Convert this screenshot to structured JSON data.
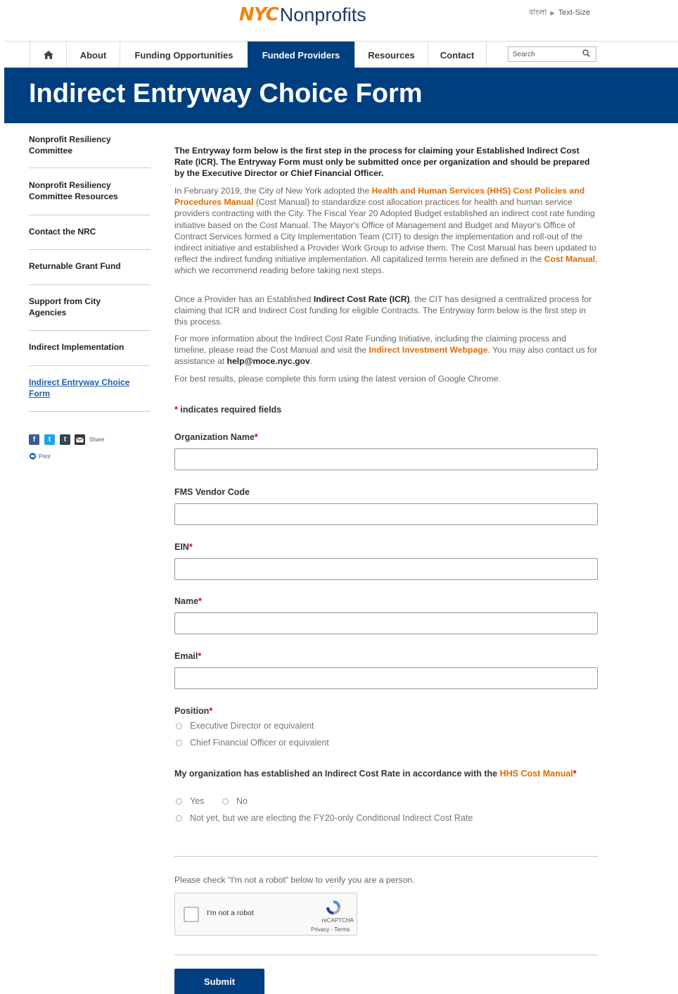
{
  "header": {
    "logo_nyc": "NYC",
    "logo_text": "Nonprofits",
    "lang_link": "বাংলা",
    "text_size": "Text-Size"
  },
  "nav": {
    "items": [
      {
        "label": "About"
      },
      {
        "label": "Funding Opportunities"
      },
      {
        "label": "Funded Providers"
      },
      {
        "label": "Resources"
      },
      {
        "label": "Contact"
      }
    ],
    "search_placeholder": "Search"
  },
  "page_title": "Indirect Entryway Choice Form",
  "sidebar": {
    "items": [
      {
        "label": "Nonprofit Resiliency Committee"
      },
      {
        "label": "Nonprofit Resiliency Committee Resources"
      },
      {
        "label": "Contact the NRC"
      },
      {
        "label": "Returnable Grant Fund"
      },
      {
        "label": "Support from City Agencies"
      },
      {
        "label": "Indirect Implementation"
      },
      {
        "label": "Indirect Entryway Choice Form"
      }
    ],
    "share_label": "Share",
    "print_label": "Print"
  },
  "content": {
    "lead": "The Entryway form below is the first step in the process for claiming your Established Indirect Cost Rate (ICR). The Entryway Form must only be submitted once per organization and should be prepared by the Executive Director or Chief Financial Officer.",
    "p1_a": "In February 2019, the City of New York adopted the ",
    "p1_link": "Health and Human Services (HHS) Cost Policies and Procedures Manual",
    "p1_b": " (Cost Manual) to standardize cost allocation practices for health and human service providers contracting with the City. The Fiscal Year 20 Adopted Budget established an indirect cost rate funding initiative based on the Cost Manual. The Mayor's Office of Management and Budget and Mayor's Office of Contract Services formed a City Implementation Team (CIT) to design the implementation and roll-out of the indirect initiative and established a Provider Work Group to advise them. The Cost Manual has been updated to reflect the indirect funding initiative implementation. All capitalized terms herein are defined in the ",
    "p1_link2": "Cost Manual",
    "p1_c": ", which we recommend reading before taking next steps.",
    "p2_a": "Once a Provider has an Established ",
    "p2_bold": "Indirect Cost Rate (ICR)",
    "p2_b": ", the CIT has designed a centralized process for claiming that ICR and Indirect Cost funding for eligible Contracts. The Entryway form below is the first step in this process.",
    "p3_a": "For more information about the Indirect Cost Rate Funding Initiative, including the claiming process and timeline, please read the Cost Manual and visit the ",
    "p3_link": "Indirect Investment Webpage",
    "p3_b": ". You may also contact us for assistance at ",
    "p3_email": "help@moce.nyc.gov",
    "p3_c": ".",
    "p4": "For best results, please complete this form using the latest version of Google Chrome."
  },
  "form": {
    "required_note": "indicates required fields",
    "required_star": "*",
    "fields": [
      {
        "label": "Organization Name",
        "required": "*",
        "value": ""
      },
      {
        "label": "FMS Vendor Code",
        "required": "",
        "value": ""
      },
      {
        "label": "EIN",
        "required": "*",
        "value": ""
      },
      {
        "label": "Name",
        "required": "*",
        "value": ""
      },
      {
        "label": "Email",
        "required": "*",
        "value": ""
      }
    ],
    "position_label": "Position",
    "position_options": [
      "Executive Director or equivalent",
      "Chief Financial Officer or equivalent"
    ],
    "icr_question_a": "My organization has established an Indirect Cost Rate in accordance with the ",
    "icr_question_link": "HHS Cost Manual",
    "icr_options": [
      "Yes",
      "No",
      "Not yet, but we are electing the FY20-only Conditional Indirect Cost Rate"
    ],
    "captcha_prompt": "Please check \"I'm not a robot\" below to verify you are a person.",
    "captcha_label": "I'm not a robot",
    "captcha_brand": "reCAPTCHA",
    "captcha_links": "Privacy - Terms",
    "submit_label": "Submit"
  }
}
